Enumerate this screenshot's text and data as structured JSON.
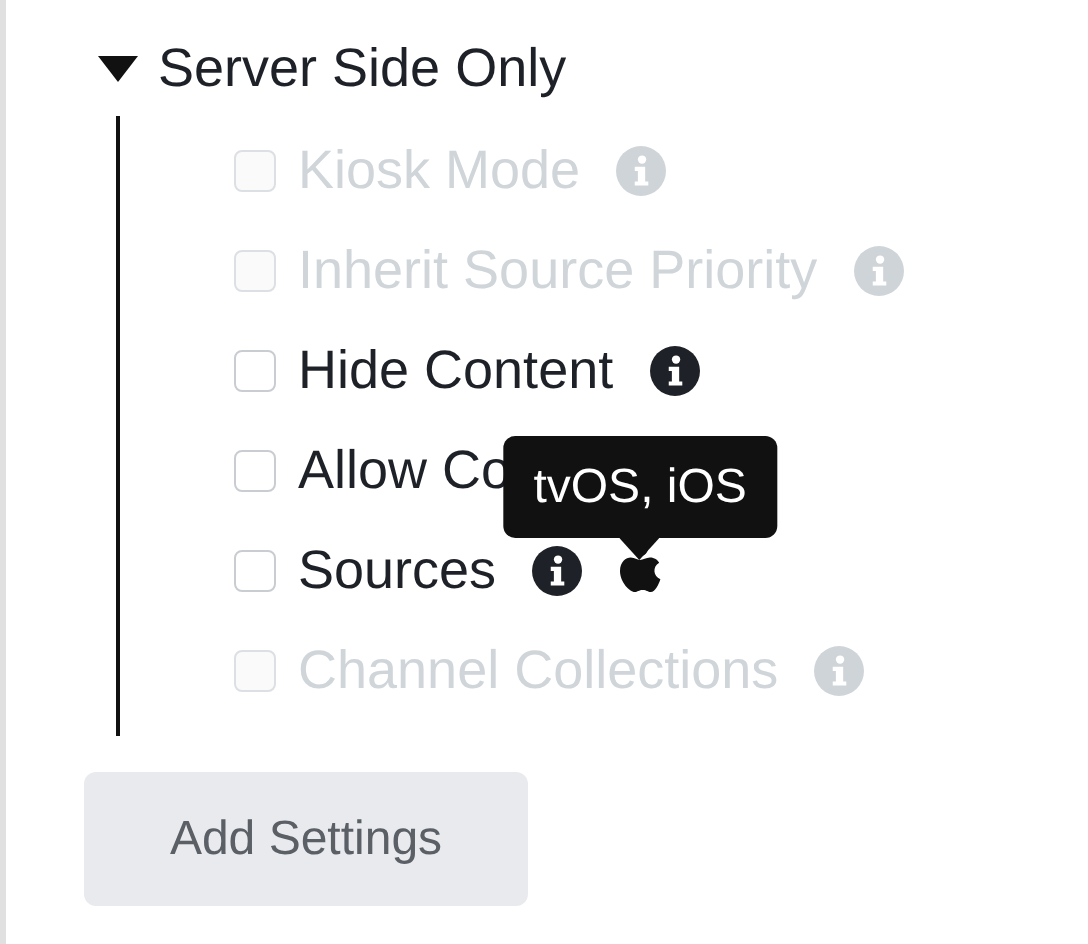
{
  "section": {
    "title": "Server Side Only",
    "expanded": true
  },
  "options": [
    {
      "label": "Kiosk Mode",
      "checked": false,
      "disabled": true,
      "info": true
    },
    {
      "label": "Inherit Source Priority",
      "checked": false,
      "disabled": true,
      "info": true
    },
    {
      "label": "Hide Content",
      "checked": false,
      "disabled": false,
      "info": true
    },
    {
      "label": "Allow Co",
      "checked": false,
      "disabled": false,
      "info": false
    },
    {
      "label": "Sources",
      "checked": false,
      "disabled": false,
      "info": true,
      "platform_icon": true,
      "tooltip": "tvOS, iOS"
    },
    {
      "label": "Channel Collections",
      "checked": false,
      "disabled": true,
      "info": true
    }
  ],
  "add_button": {
    "label": "Add Settings"
  }
}
